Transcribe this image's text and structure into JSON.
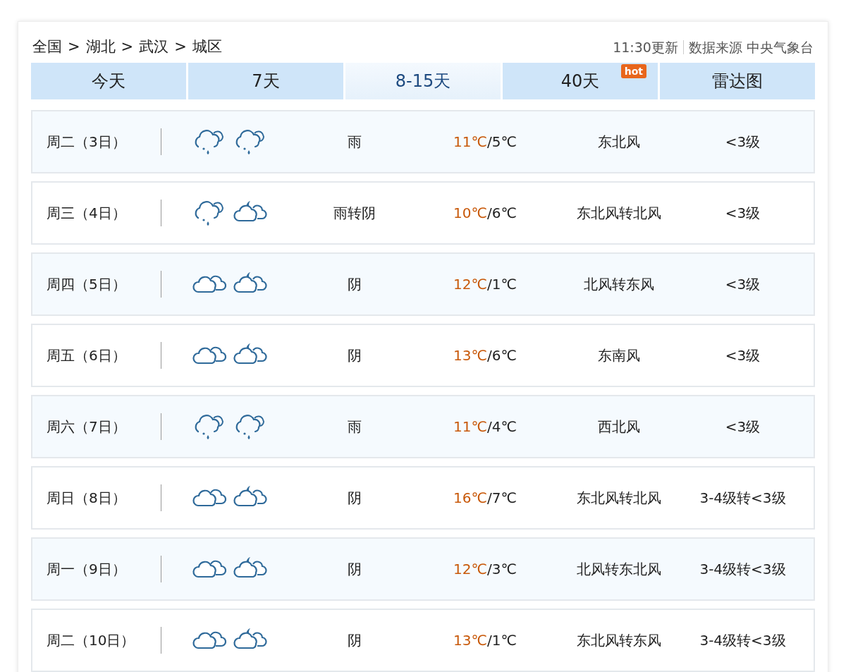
{
  "breadcrumb": [
    "全国",
    "湖北",
    "武汉",
    "城区"
  ],
  "breadcrumb_separator": ">",
  "update": {
    "time": "11:30更新",
    "source": "数据来源 中央气象台"
  },
  "tabs": [
    {
      "label": "今天",
      "selected": false
    },
    {
      "label": "7天",
      "selected": false
    },
    {
      "label": "8-15天",
      "selected": true
    },
    {
      "label": "40天",
      "selected": false,
      "badge": "hot"
    },
    {
      "label": "雷达图",
      "selected": false
    }
  ],
  "days": [
    {
      "date": "周二（3日）",
      "icons": [
        {
          "kind": "rain"
        },
        {
          "kind": "rain"
        }
      ],
      "weather": "雨",
      "high": "11℃",
      "low": "/5℃",
      "wind": "东北风",
      "level": "<3级"
    },
    {
      "date": "周三（4日）",
      "icons": [
        {
          "kind": "rain"
        },
        {
          "kind": "cloudy-night"
        }
      ],
      "weather": "雨转阴",
      "high": "10℃",
      "low": "/6℃",
      "wind": "东北风转北风",
      "level": "<3级"
    },
    {
      "date": "周四（5日）",
      "icons": [
        {
          "kind": "overcast"
        },
        {
          "kind": "cloudy-night"
        }
      ],
      "weather": "阴",
      "high": "12℃",
      "low": "/1℃",
      "wind": "北风转东风",
      "level": "<3级"
    },
    {
      "date": "周五（6日）",
      "icons": [
        {
          "kind": "overcast"
        },
        {
          "kind": "cloudy-night"
        }
      ],
      "weather": "阴",
      "high": "13℃",
      "low": "/6℃",
      "wind": "东南风",
      "level": "<3级"
    },
    {
      "date": "周六（7日）",
      "icons": [
        {
          "kind": "rain"
        },
        {
          "kind": "rain"
        }
      ],
      "weather": "雨",
      "high": "11℃",
      "low": "/4℃",
      "wind": "西北风",
      "level": "<3级"
    },
    {
      "date": "周日（8日）",
      "icons": [
        {
          "kind": "overcast"
        },
        {
          "kind": "cloudy-night"
        }
      ],
      "weather": "阴",
      "high": "16℃",
      "low": "/7℃",
      "wind": "东北风转北风",
      "level": "3-4级转<3级"
    },
    {
      "date": "周一（9日）",
      "icons": [
        {
          "kind": "overcast"
        },
        {
          "kind": "cloudy-night"
        }
      ],
      "weather": "阴",
      "high": "12℃",
      "low": "/3℃",
      "wind": "北风转东北风",
      "level": "3-4级转<3级"
    },
    {
      "date": "周二（10日）",
      "icons": [
        {
          "kind": "overcast"
        },
        {
          "kind": "cloudy-night"
        }
      ],
      "weather": "阴",
      "high": "13℃",
      "low": "/1℃",
      "wind": "东北风转东风",
      "level": "3-4级转<3级"
    }
  ]
}
